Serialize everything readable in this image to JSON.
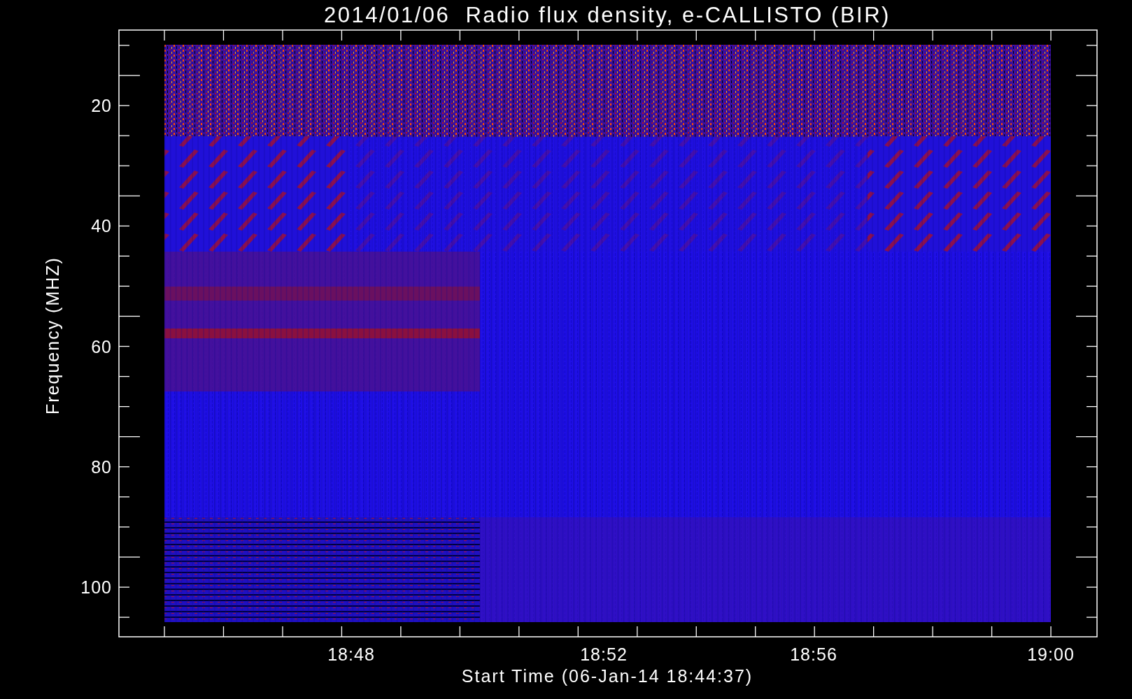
{
  "title": "2014/01/06  Radio flux density, e-CALLISTO (BIR)",
  "y_axis": {
    "label": "Frequency (MHZ)",
    "ticks": [
      "20",
      "40",
      "60",
      "80",
      "100"
    ]
  },
  "x_axis": {
    "label": "Start Time (06-Jan-14 18:44:37)",
    "ticks": [
      "18:48",
      "18:52",
      "18:56",
      "19:00"
    ]
  }
}
